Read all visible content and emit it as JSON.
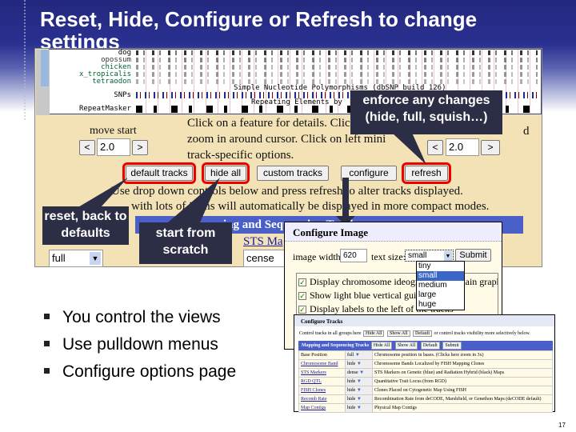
{
  "slide": {
    "title": "Reset, Hide, Configure or Refresh to change settings",
    "page_number": "17",
    "bullets": [
      "You control the views",
      "Use pulldown menus",
      "Configure options page"
    ]
  },
  "browser": {
    "tracks": [
      "dog",
      "opossum",
      "chicken",
      "x_tropicalis",
      "tetraodon",
      "SNPs",
      "RepeatMasker"
    ],
    "snp_caption": "Simple Nucleotide Polymorphisms (dbSNP build 126)",
    "repeat_caption": "Repeating Elements by",
    "move_start": "move start",
    "move_start_value": "2.0",
    "move_end_fragment": "d",
    "move_end_value": "2.0",
    "left_arrow": "<",
    "right_arrow": ">",
    "help_text": [
      "Click on a feature for details. Click",
      "zoom in around cursor. Click on left mini",
      "track-specific options."
    ],
    "buttons": {
      "default_tracks": "default tracks",
      "hide_all": "hide all",
      "custom_tracks": "custom tracks",
      "configure": "configure",
      "refresh": "refresh"
    },
    "instructions": [
      "Use drop down controls below and press refresh to alter tracks displayed.",
      "with lots of items will automatically be displayed in more compact modes."
    ],
    "group_bar": "ing and Sequencing Track",
    "sts_link": "STS Ma",
    "select_full": "full",
    "select_dense": "cense"
  },
  "callouts": {
    "refresh": "enforce any changes (hide, full, squish…)",
    "defaults": "reset, back to defaults",
    "hide_all": "start from scratch"
  },
  "configure_image": {
    "title": "Configure Image",
    "width_label": "image width:",
    "width_value": "620",
    "text_size_label": "text size:",
    "text_size_value": "small",
    "submit": "Submit",
    "text_size_options": [
      "tiny",
      "small",
      "medium",
      "large",
      "huge"
    ],
    "checkboxes": [
      "Display chromosome ideogram above main graphic",
      "Show light blue vertical guidelines",
      "Display labels to the left of the tracks"
    ]
  },
  "configure_tracks": {
    "title": "Configure Tracks",
    "control_text": "Control tracks in all groups here",
    "hide_all": "Hide All",
    "show_all": "Show All",
    "default": "Default",
    "control_text2": "or control tracks visibility more selectively below.",
    "group": "Mapping and Sequencing Tracks",
    "submit": "Submit",
    "rows": [
      {
        "name": "Base Position",
        "mode": "full",
        "desc": "Chromosome position in bases. (Clicks here zoom in 3x)"
      },
      {
        "name": "Chromosome Band",
        "mode": "hide",
        "desc": "Chromosome Bands Localized by FISH Mapping Clones"
      },
      {
        "name": "STS Markers",
        "mode": "dense",
        "desc": "STS Markers on Genetic (blue) and Radiation Hybrid (black) Maps"
      },
      {
        "name": "RGD QTL",
        "mode": "hide",
        "desc": "Quantitative Trait Locus (from RGD)"
      },
      {
        "name": "FISH Clones",
        "mode": "hide",
        "desc": "Clones Placed on Cytogenetic Map Using FISH"
      },
      {
        "name": "Recomb Rate",
        "mode": "hide",
        "desc": "Recombination Rate from deCODE, Marshfield, or Genethon Maps (deCODE default)"
      },
      {
        "name": "Map Contigs",
        "mode": "hide",
        "desc": "Physical Map Contigs"
      }
    ]
  },
  "colors": {
    "title_bg": "#23287e",
    "highlight": "#e00000",
    "callout": "#2c2e45",
    "parchment": "#f2e2b6"
  }
}
